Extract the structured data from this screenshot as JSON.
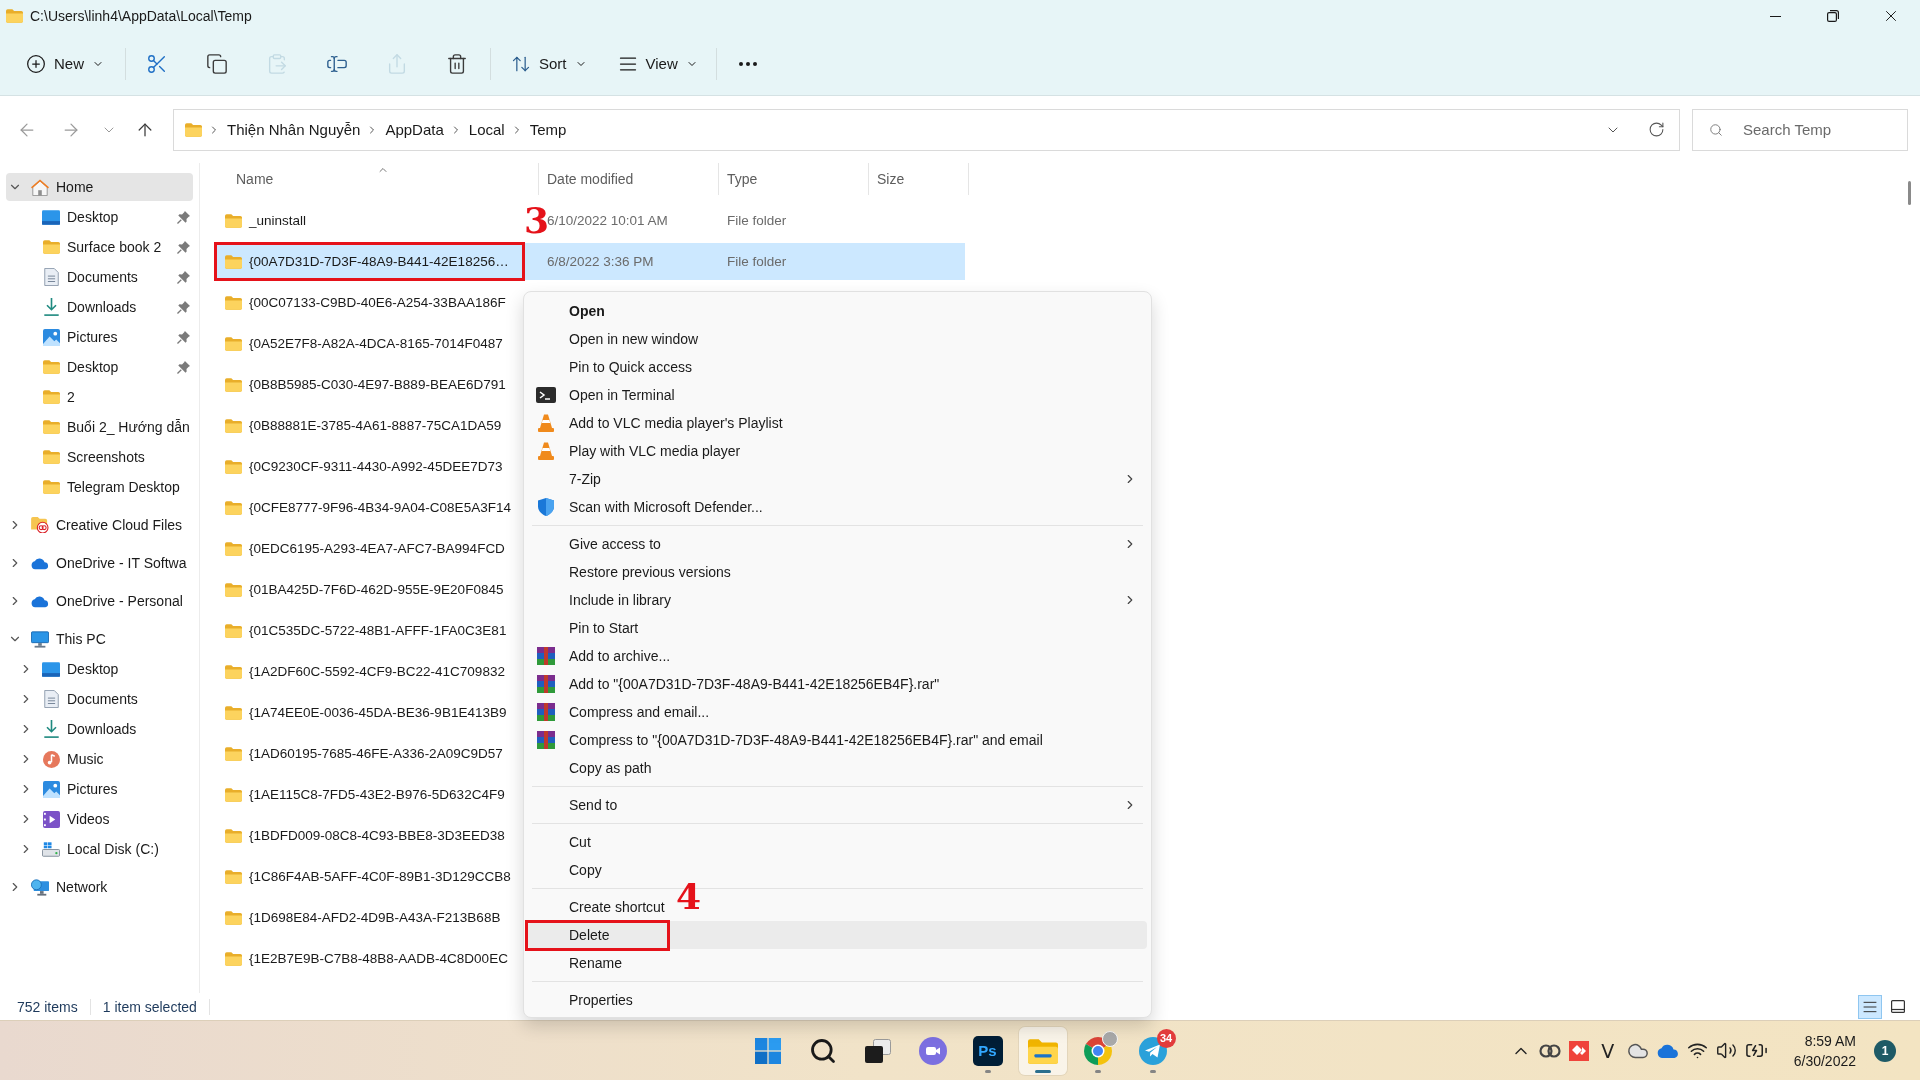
{
  "window": {
    "title": "C:\\Users\\linh4\\AppData\\Local\\Temp"
  },
  "toolbar": {
    "new": {
      "label": "New"
    },
    "actions": [
      {
        "kind": "cut",
        "disabled": false
      },
      {
        "kind": "copy",
        "disabled": false
      },
      {
        "kind": "paste",
        "disabled": true
      },
      {
        "kind": "rename",
        "disabled": false
      },
      {
        "kind": "share",
        "disabled": true
      },
      {
        "kind": "delete",
        "disabled": false
      }
    ],
    "sort": {
      "label": "Sort"
    },
    "view": {
      "label": "View"
    }
  },
  "nav_buttons": [
    {
      "kind": "back",
      "disabled": true
    },
    {
      "kind": "forward",
      "disabled": true
    },
    {
      "kind": "recent",
      "disabled": true
    },
    {
      "kind": "up",
      "disabled": false
    }
  ],
  "address_bar": {
    "path": [
      "Thiện Nhân Nguyễn",
      "AppData",
      "Local",
      "Temp"
    ]
  },
  "search": {
    "placeholder": "Search Temp"
  },
  "sidebar": {
    "items": [
      {
        "label": "Home",
        "kind": "home",
        "expanded": true,
        "selected": true,
        "children": [
          {
            "label": "Desktop",
            "kind": "desktop",
            "pinned": true,
            "selected": false
          },
          {
            "label": "Surface book 2",
            "kind": "folder",
            "pinned": true,
            "selected": false
          },
          {
            "label": "Documents",
            "kind": "documents",
            "pinned": true,
            "selected": false
          },
          {
            "label": "Downloads",
            "kind": "downloads",
            "pinned": true,
            "selected": false
          },
          {
            "label": "Pictures",
            "kind": "pictures",
            "pinned": true,
            "selected": false
          },
          {
            "label": "Desktop",
            "kind": "folder",
            "pinned": true,
            "selected": false
          },
          {
            "label": "2",
            "kind": "folder",
            "pinned": false,
            "selected": false
          },
          {
            "label": "Buổi 2_ Hướng dẫn",
            "kind": "folder",
            "pinned": false,
            "selected": false
          },
          {
            "label": "Screenshots",
            "kind": "folder",
            "pinned": false,
            "selected": false
          },
          {
            "label": "Telegram Desktop",
            "kind": "folder",
            "pinned": false,
            "selected": false
          }
        ]
      },
      {
        "label": "Creative Cloud Files",
        "kind": "creative_cloud",
        "expanded": false,
        "selected": false
      },
      {
        "label": "OneDrive - IT Softwa",
        "kind": "onedrive",
        "expanded": false,
        "selected": false
      },
      {
        "label": "OneDrive - Personal",
        "kind": "onedrive",
        "expanded": false,
        "selected": false
      },
      {
        "label": "This PC",
        "kind": "pc",
        "expanded": true,
        "selected": false,
        "children": [
          {
            "label": "Desktop",
            "kind": "desktop",
            "expanded": false,
            "selected": false
          },
          {
            "label": "Documents",
            "kind": "documents",
            "expanded": false,
            "selected": false
          },
          {
            "label": "Downloads",
            "kind": "downloads",
            "expanded": false,
            "selected": false
          },
          {
            "label": "Music",
            "kind": "music",
            "expanded": false,
            "selected": false
          },
          {
            "label": "Pictures",
            "kind": "pictures",
            "expanded": false,
            "selected": false
          },
          {
            "label": "Videos",
            "kind": "videos",
            "expanded": false,
            "selected": false
          },
          {
            "label": "Local Disk (C:)",
            "kind": "disk",
            "expanded": false,
            "selected": false
          }
        ]
      },
      {
        "label": "Network",
        "kind": "network",
        "expanded": false,
        "selected": false
      }
    ]
  },
  "file_list": {
    "columns": [
      {
        "label": "Name",
        "sorted": true
      },
      {
        "label": "Date modified",
        "sorted": false
      },
      {
        "label": "Type",
        "sorted": false
      },
      {
        "label": "Size",
        "sorted": false
      }
    ],
    "rows": [
      {
        "name": "_uninstall",
        "date": "6/10/2022 10:01 AM",
        "type": "File folder",
        "selected": false
      },
      {
        "name": "{00A7D31D-7D3F-48A9-B441-42E18256…",
        "date": "6/8/2022 3:36 PM",
        "type": "File folder",
        "selected": true,
        "annotation": "3"
      },
      {
        "name": "{00C07133-C9BD-40E6-A254-33BAA186F",
        "selected": false
      },
      {
        "name": "{0A52E7F8-A82A-4DCA-8165-7014F0487",
        "selected": false
      },
      {
        "name": "{0B8B5985-C030-4E97-B889-BEAE6D791",
        "selected": false
      },
      {
        "name": "{0B88881E-3785-4A61-8887-75CA1DA59",
        "selected": false
      },
      {
        "name": "{0C9230CF-9311-4430-A992-45DEE7D73",
        "selected": false
      },
      {
        "name": "{0CFE8777-9F96-4B34-9A04-C08E5A3F14",
        "selected": false
      },
      {
        "name": "{0EDC6195-A293-4EA7-AFC7-BA994FCD",
        "selected": false
      },
      {
        "name": "{01BA425D-7F6D-462D-955E-9E20F0845",
        "selected": false
      },
      {
        "name": "{01C535DC-5722-48B1-AFFF-1FA0C3E81",
        "selected": false
      },
      {
        "name": "{1A2DF60C-5592-4CF9-BC22-41C709832",
        "selected": false
      },
      {
        "name": "{1A74EE0E-0036-45DA-BE36-9B1E413B9",
        "selected": false
      },
      {
        "name": "{1AD60195-7685-46FE-A336-2A09C9D57",
        "selected": false
      },
      {
        "name": "{1AE115C8-7FD5-43E2-B976-5D632C4F9",
        "selected": false
      },
      {
        "name": "{1BDFD009-08C8-4C93-BBE8-3D3EED38",
        "selected": false
      },
      {
        "name": "{1C86F4AB-5AFF-4C0F-89B1-3D129CCB8",
        "selected": false
      },
      {
        "name": "{1D698E84-AFD2-4D9B-A43A-F213B68B",
        "selected": false
      },
      {
        "name": "{1E2B7E9B-C7B8-48B8-AADB-4C8D00EC",
        "selected": false
      }
    ]
  },
  "context_menu": {
    "groups": [
      [
        {
          "label": "Open",
          "kind": "plain",
          "default": true,
          "submenu": false,
          "selected": false
        },
        {
          "label": "Open in new window",
          "kind": "plain",
          "default": false,
          "submenu": false,
          "selected": false
        },
        {
          "label": "Pin to Quick access",
          "kind": "plain",
          "default": false,
          "submenu": false,
          "selected": false
        },
        {
          "label": "Open in Terminal",
          "kind": "terminal",
          "default": false,
          "submenu": false,
          "selected": false
        },
        {
          "label": "Add to VLC media player's Playlist",
          "kind": "vlc",
          "default": false,
          "submenu": false,
          "selected": false
        },
        {
          "label": "Play with VLC media player",
          "kind": "vlc",
          "default": false,
          "submenu": false,
          "selected": false
        },
        {
          "label": "7-Zip",
          "kind": "plain",
          "default": false,
          "submenu": true,
          "selected": false
        },
        {
          "label": "Scan with Microsoft Defender...",
          "kind": "defender",
          "default": false,
          "submenu": false,
          "selected": false
        }
      ],
      [
        {
          "label": "Give access to",
          "kind": "plain",
          "default": false,
          "submenu": true,
          "selected": false
        },
        {
          "label": "Restore previous versions",
          "kind": "plain",
          "default": false,
          "submenu": false,
          "selected": false
        },
        {
          "label": "Include in library",
          "kind": "plain",
          "default": false,
          "submenu": true,
          "selected": false
        },
        {
          "label": "Pin to Start",
          "kind": "plain",
          "default": false,
          "submenu": false,
          "selected": false
        },
        {
          "label": "Add to archive...",
          "kind": "archive",
          "default": false,
          "submenu": false,
          "selected": false
        },
        {
          "label": "Add to \"{00A7D31D-7D3F-48A9-B441-42E18256EB4F}.rar\"",
          "kind": "archive",
          "default": false,
          "submenu": false,
          "selected": false
        },
        {
          "label": "Compress and email...",
          "kind": "archive",
          "default": false,
          "submenu": false,
          "selected": false
        },
        {
          "label": "Compress to \"{00A7D31D-7D3F-48A9-B441-42E18256EB4F}.rar\" and email",
          "kind": "archive",
          "default": false,
          "submenu": false,
          "selected": false
        },
        {
          "label": "Copy as path",
          "kind": "plain",
          "default": false,
          "submenu": false,
          "selected": false
        }
      ],
      [
        {
          "label": "Send to",
          "kind": "plain",
          "default": false,
          "submenu": true,
          "selected": false
        }
      ],
      [
        {
          "label": "Cut",
          "kind": "plain",
          "default": false,
          "submenu": false,
          "selected": false
        },
        {
          "label": "Copy",
          "kind": "plain",
          "default": false,
          "submenu": false,
          "selected": false
        }
      ],
      [
        {
          "label": "Create shortcut",
          "kind": "plain",
          "default": false,
          "submenu": false,
          "selected": false
        },
        {
          "label": "Delete",
          "kind": "plain",
          "default": false,
          "submenu": false,
          "selected": true,
          "annotation": "4"
        },
        {
          "label": "Rename",
          "kind": "plain",
          "default": false,
          "submenu": false,
          "selected": false
        }
      ],
      [
        {
          "label": "Properties",
          "kind": "plain",
          "default": false,
          "submenu": false,
          "selected": false
        }
      ]
    ]
  },
  "status_bar": {
    "item_count": "752 items",
    "selection": "1 item selected",
    "views": [
      {
        "kind": "details",
        "selected": true
      },
      {
        "kind": "tiles",
        "selected": false
      }
    ]
  },
  "taskbar": {
    "apps": [
      {
        "kind": "start",
        "running": false,
        "selected": false
      },
      {
        "kind": "search",
        "running": false,
        "selected": false
      },
      {
        "kind": "task_view",
        "running": false,
        "selected": false
      },
      {
        "kind": "chat",
        "running": false,
        "selected": false
      },
      {
        "kind": "photoshop",
        "label": "Ps",
        "running": true,
        "selected": false
      },
      {
        "kind": "explorer",
        "running": true,
        "selected": true
      },
      {
        "kind": "chrome",
        "running": true,
        "selected": false
      },
      {
        "kind": "telegram",
        "badge": "34",
        "running": true,
        "selected": false
      }
    ],
    "tray": [
      {
        "kind": "overflow"
      },
      {
        "kind": "creative_cloud"
      },
      {
        "kind": "remote_desktop"
      },
      {
        "kind": "input_method",
        "label": "V"
      },
      {
        "kind": "cloud"
      },
      {
        "kind": "onedrive"
      },
      {
        "kind": "wifi"
      },
      {
        "kind": "volume"
      },
      {
        "kind": "battery"
      }
    ],
    "time": "8:59 AM",
    "date": "6/30/2022",
    "notifications": "1"
  }
}
